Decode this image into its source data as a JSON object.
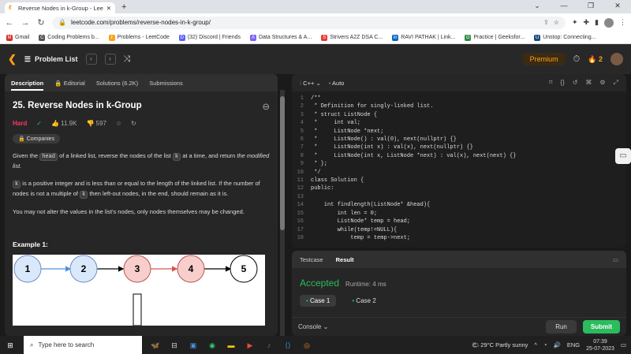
{
  "browser": {
    "tab_title": "Reverse Nodes in k-Group - Leet",
    "url": "leetcode.com/problems/reverse-nodes-in-k-group/",
    "bookmarks": [
      "Gmail",
      "Coding Problems b...",
      "Problems - LeetCode",
      "(32) Discord | Friends",
      "Data Structures & A...",
      "Strivers A2Z DSA C...",
      "RAVI PATHAK | Link...",
      "Practice | Geeksfor...",
      "Unstop: Connecting..."
    ]
  },
  "lc_nav": {
    "problem_list": "Problem List",
    "premium": "Premium",
    "streak": "2"
  },
  "left_tabs": [
    "Description",
    "Editorial",
    "Solutions (6.2K)",
    "Submissions"
  ],
  "problem": {
    "title": "25. Reverse Nodes in k-Group",
    "difficulty": "Hard",
    "likes": "11.9K",
    "dislikes": "597",
    "companies": "Companies",
    "p1_a": "Given the ",
    "p1_code1": "head",
    "p1_b": " of a linked list, reverse the nodes of the list ",
    "p1_code2": "k",
    "p1_c": " at a time, and return ",
    "p1_d": "the modified list.",
    "p2_code": "k",
    "p2_a": " is a positive integer and is less than or equal to the length of the linked list. If the number of nodes is not a multiple of ",
    "p2_code2": "k",
    "p2_b": " then left-out nodes, in the end, should remain as it is.",
    "p3": "You may not alter the values in the list's nodes, only nodes themselves may be changed.",
    "example": "Example 1:",
    "nodes": [
      "1",
      "2",
      "3",
      "4",
      "5"
    ]
  },
  "editor": {
    "language": "C++",
    "mode": "Auto",
    "lines": [
      {
        "n": "1",
        "t": "/**",
        "cls": "cm"
      },
      {
        "n": "2",
        "t": " * Definition for singly-linked list.",
        "cls": "cm"
      },
      {
        "n": "3",
        "t": " * struct ListNode {",
        "cls": "cm"
      },
      {
        "n": "4",
        "t": " *     int val;",
        "cls": "cm"
      },
      {
        "n": "5",
        "t": " *     ListNode *next;",
        "cls": "cm"
      },
      {
        "n": "6",
        "t": " *     ListNode() : val(0), next(nullptr) {}",
        "cls": "cm"
      },
      {
        "n": "7",
        "t": " *     ListNode(int x) : val(x), next(nullptr) {}",
        "cls": "cm"
      },
      {
        "n": "8",
        "t": " *     ListNode(int x, ListNode *next) : val(x), next(next) {}",
        "cls": "cm"
      },
      {
        "n": "9",
        "t": " * };",
        "cls": "cm"
      },
      {
        "n": "10",
        "t": " */",
        "cls": "cm"
      },
      {
        "n": "11",
        "t": "class Solution {",
        "cls": "kw"
      },
      {
        "n": "12",
        "t": "public:",
        "cls": "kw"
      },
      {
        "n": "13",
        "t": "",
        "cls": ""
      },
      {
        "n": "14",
        "t": "    int findlength(ListNode* &head){",
        "cls": ""
      },
      {
        "n": "15",
        "t": "        int len = 0;",
        "cls": ""
      },
      {
        "n": "16",
        "t": "        ListNode* temp = head;",
        "cls": ""
      },
      {
        "n": "17",
        "t": "        while(temp!=NULL){",
        "cls": ""
      },
      {
        "n": "18",
        "t": "            temp = temp->next;",
        "cls": ""
      }
    ]
  },
  "result": {
    "tabs": [
      "Testcase",
      "Result"
    ],
    "status": "Accepted",
    "runtime": "Runtime: 4 ms",
    "cases": [
      "Case 1",
      "Case 2"
    ],
    "console": "Console",
    "run": "Run",
    "submit": "Submit"
  },
  "taskbar": {
    "search": "Type here to search",
    "weather": "29°C  Partly sunny",
    "lang": "ENG",
    "time": "07:39",
    "date": "25-07-2023"
  },
  "colors": {
    "accent": "#ffa116",
    "accepted": "#2cbb5d",
    "hard": "#ff375f"
  }
}
